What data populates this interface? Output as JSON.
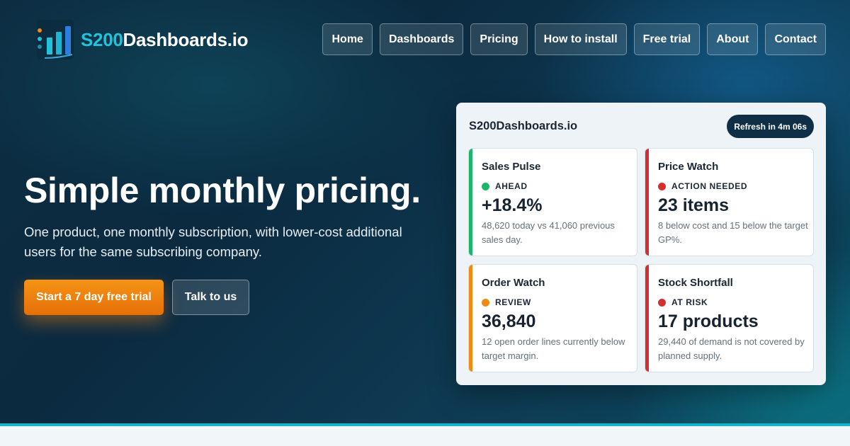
{
  "brand": {
    "name_highlight": "S200",
    "name_rest": "Dashboards.io",
    "logo_icon": "bar-chart-logo-icon",
    "colors": {
      "accent": "#22c3da",
      "cta": "#f08a12",
      "bg": "#0d2d42"
    }
  },
  "nav": {
    "items": [
      {
        "label": "Home"
      },
      {
        "label": "Dashboards"
      },
      {
        "label": "Pricing"
      },
      {
        "label": "How to install"
      },
      {
        "label": "Free trial"
      },
      {
        "label": "About"
      },
      {
        "label": "Contact"
      }
    ]
  },
  "hero": {
    "headline": "Simple monthly pricing.",
    "subhead": "One product, one monthly subscription, with lower-cost additional users for the same subscribing company.",
    "cta_primary": "Start a 7 day free trial",
    "cta_secondary": "Talk to us"
  },
  "dashboard": {
    "title": "S200Dashboards.io",
    "refresh": "Refresh in 4m 06s",
    "tiles": [
      {
        "title": "Sales Pulse",
        "status": "AHEAD",
        "status_color": "#1db56a",
        "stripe_color": "#1db56a",
        "value": "+18.4%",
        "desc": "48,620 today vs 41,060 previous sales day."
      },
      {
        "title": "Price Watch",
        "status": "ACTION NEEDED",
        "status_color": "#d42e2e",
        "stripe_color": "#d42e2e",
        "value": "23 items",
        "desc": "8 below cost and 15 below the target GP%."
      },
      {
        "title": "Order Watch",
        "status": "REVIEW",
        "status_color": "#f08a12",
        "stripe_color": "#f08a12",
        "value": "36,840",
        "desc": "12 open order lines currently below target margin."
      },
      {
        "title": "Stock Shortfall",
        "status": "AT RISK",
        "status_color": "#d42e2e",
        "stripe_color": "#d42e2e",
        "value": "17 products",
        "desc": "29,440 of demand is not covered by planned supply."
      }
    ]
  }
}
